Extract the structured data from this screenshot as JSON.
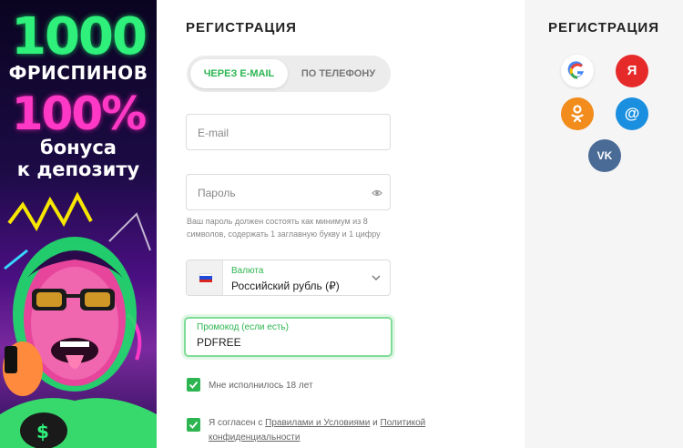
{
  "promo": {
    "big_number": "1000",
    "freespins": "ФРИСПИНОВ",
    "percent": "100%",
    "bonus_line1": "бонуса",
    "bonus_line2": "к депозиту"
  },
  "form": {
    "title": "РЕГИСТРАЦИЯ",
    "tabs": [
      {
        "label": "ЧЕРЕЗ E-MAIL",
        "active": true
      },
      {
        "label": "ПО ТЕЛЕФОНУ",
        "active": false
      }
    ],
    "email": {
      "placeholder": "E-mail"
    },
    "password": {
      "placeholder": "Пароль",
      "hint": "Ваш пароль должен состоять как минимум из 8 символов, содержать 1 заглавную букву и 1 цифру"
    },
    "currency": {
      "label": "Валюта",
      "value": "Российский рубль (₽)"
    },
    "promocode": {
      "label": "Промокод (если есть)",
      "value": "PDFREE"
    },
    "age_check": {
      "label": "Мне исполнилось 18 лет",
      "checked": true
    },
    "terms_check": {
      "prefix": "Я согласен с",
      "terms_link": "Правилами и Условиями",
      "and": "и",
      "privacy_link_1": "Политикой",
      "privacy_link_2": "конфиденциальности",
      "checked": true
    }
  },
  "side": {
    "title": "РЕГИСТРАЦИЯ",
    "providers": [
      {
        "name": "google",
        "icon": "google-icon",
        "glyph": "G",
        "color": "#ffffff"
      },
      {
        "name": "yandex",
        "icon": "yandex-icon",
        "glyph": "Я",
        "color": "#e62a2a"
      },
      {
        "name": "odnoklassniki",
        "icon": "ok-icon",
        "glyph": "",
        "color": "#f28c1c"
      },
      {
        "name": "mail.ru",
        "icon": "mail-at-icon",
        "glyph": "@",
        "color": "#1a8fe0"
      },
      {
        "name": "vk",
        "icon": "vk-icon",
        "glyph": "VK",
        "color": "#4a6b96"
      }
    ]
  },
  "colors": {
    "accent": "#2cb550",
    "promo_green": "#2ef07a",
    "promo_pink": "#ff39c6"
  }
}
